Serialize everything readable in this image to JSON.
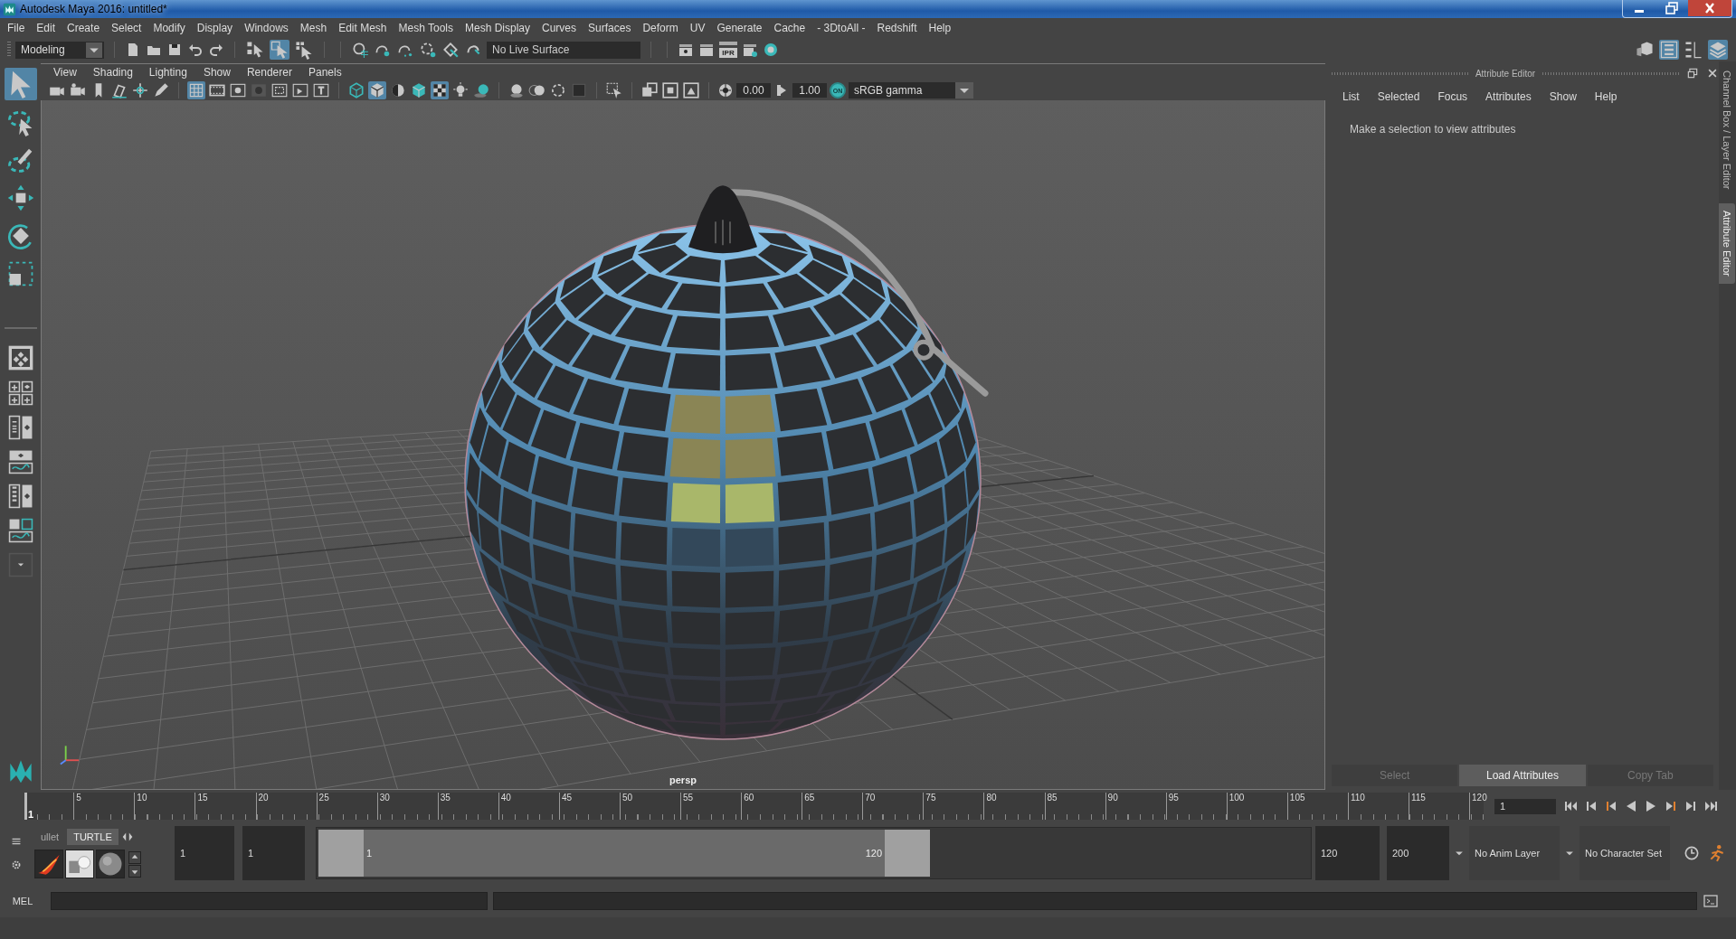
{
  "window": {
    "title": "Autodesk Maya 2016: untitled*"
  },
  "menu_bar": [
    "File",
    "Edit",
    "Create",
    "Select",
    "Modify",
    "Display",
    "Windows",
    "Mesh",
    "Edit Mesh",
    "Mesh Tools",
    "Mesh Display",
    "Curves",
    "Surfaces",
    "Deform",
    "UV",
    "Generate",
    "Cache",
    "- 3DtoAll -",
    "Redshift",
    "Help"
  ],
  "status_line": {
    "menu_set": "Modeling",
    "select_modes": [
      {
        "selected": false
      },
      {
        "selected": true
      },
      {
        "selected": false
      }
    ],
    "live_surface": "No Live Surface",
    "ipr": "IPR",
    "panel_toggles": [
      {
        "selected": false
      },
      {
        "selected": true
      },
      {
        "selected": false
      },
      {
        "selected": true
      }
    ]
  },
  "toolbox": {
    "tools": [
      {
        "selected": true
      },
      {
        "selected": false
      },
      {
        "selected": false
      },
      {
        "selected": false
      },
      {
        "selected": false
      },
      {
        "selected": false
      }
    ]
  },
  "viewport": {
    "menu": [
      "View",
      "Shading",
      "Lighting",
      "Show",
      "Renderer",
      "Panels"
    ],
    "icons": [
      {
        "selected": false
      },
      {
        "selected": false
      },
      {
        "selected": false
      },
      {
        "selected": false
      },
      {
        "selected": false
      },
      {
        "selected": false
      },
      {
        "selected": true
      },
      {
        "selected": false
      },
      {
        "selected": false
      },
      {
        "selected": false
      },
      {
        "selected": false
      },
      {
        "selected": false
      },
      {
        "selected": false
      },
      {
        "selected": false
      },
      {
        "selected": true
      },
      {
        "selected": false
      },
      {
        "selected": false
      },
      {
        "selected": true
      },
      {
        "selected": false
      },
      {
        "selected": false
      },
      {
        "selected": false
      },
      {
        "selected": false
      },
      {
        "selected": false
      },
      {
        "selected": false
      },
      {
        "selected": false
      },
      {
        "selected": false
      },
      {
        "selected": false
      },
      {
        "selected": false
      }
    ],
    "exposure": "0.00",
    "gamma": "1.00",
    "color_management": {
      "label": "ON",
      "on": true
    },
    "color_space": "sRGB gamma",
    "camera": "persp"
  },
  "attribute_editor": {
    "title": "Attribute Editor",
    "menu": [
      "List",
      "Selected",
      "Focus",
      "Attributes",
      "Show",
      "Help"
    ],
    "message": "Make a selection to view attributes",
    "buttons": [
      {
        "label": "Select",
        "disabled": true
      },
      {
        "label": "Load Attributes",
        "disabled": false
      },
      {
        "label": "Copy Tab",
        "disabled": true
      }
    ]
  },
  "side_tabs": [
    {
      "label": "Channel Box / Layer Editor",
      "selected": false
    },
    {
      "label": "Attribute Editor",
      "selected": true
    }
  ],
  "time_slider": {
    "current_time": "1",
    "ticks": [
      "5",
      "10",
      "15",
      "20",
      "25",
      "30",
      "35",
      "40",
      "45",
      "50",
      "55",
      "60",
      "65",
      "70",
      "75",
      "80",
      "85",
      "90",
      "95",
      "100",
      "105",
      "110",
      "115",
      "120"
    ],
    "current_frame": "1"
  },
  "shelf": {
    "tabs": [
      {
        "label": "ullet",
        "selected": false
      },
      {
        "label": "TURTLE",
        "selected": true
      }
    ]
  },
  "range_slider": {
    "animation_start": "1",
    "playback_start": "1",
    "range_start": "1",
    "range_end": "120",
    "playback_end": "120",
    "animation_end": "200",
    "anim_layer": "No Anim Layer",
    "character_set": "No Character Set"
  },
  "command_line": {
    "language": "MEL"
  }
}
